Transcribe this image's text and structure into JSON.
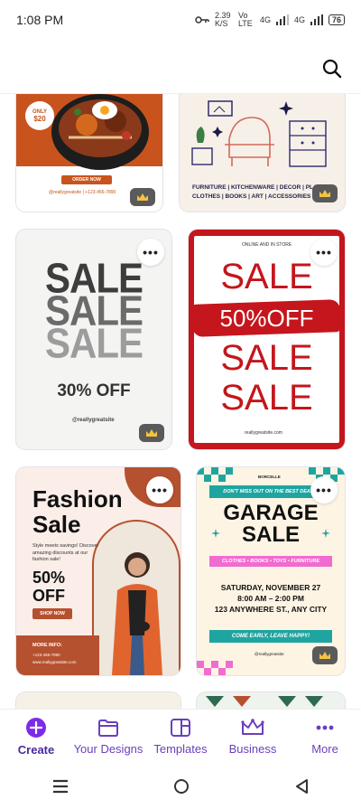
{
  "status": {
    "time": "1:08 PM",
    "net_speed": "2.39 K/S",
    "net1": "Vo LTE",
    "net2": "4G",
    "battery": "76"
  },
  "cards": {
    "food": {
      "badge_top": "ONLY",
      "badge_price": "$20",
      "button": "ORDER NOW",
      "footer": "@reallygreatsite | +123-456-7890"
    },
    "furniture": {
      "line1": "FURNITURE | KITCHENWARE | DECOR | PLANTS",
      "line2": "CLOTHES | BOOKS | ART | ACCESSORIES | SHOE"
    },
    "sale_gray": {
      "word": "SALE",
      "discount": "30% OFF",
      "handle": "@reallygreatsite"
    },
    "sale_red": {
      "top": "ONLINE AND IN STORE",
      "word": "SALE",
      "discount": "50%OFF",
      "site": "reallygreatsite.com"
    },
    "fashion": {
      "title1": "Fashion",
      "title2": "Sale",
      "desc": "Style meets savings! Discover amazing discounts at our fashion sale!",
      "discount1": "50%",
      "discount2": "OFF",
      "button": "SHOP NOW",
      "info_label": "MORE INFO:",
      "phone": "+123-456-7890",
      "site": "www.reallygreatsite.com"
    },
    "garage": {
      "brand": "BORCELLE",
      "tag": "DON'T MISS OUT ON THE BEST DEALS!",
      "title1": "GARAGE",
      "title2": "SALE",
      "items": "CLOTHES • BOOKS • TOYS • FURNITURE",
      "date": "SATURDAY, NOVEMBER 27",
      "time": "8:00 AM – 2:00 PM",
      "address": "123 ANYWHERE ST., ANY CITY",
      "cta": "COME EARLY, LEAVE HAPPY!",
      "site": "@reallygreatsite"
    }
  },
  "nav": [
    {
      "label": "Create"
    },
    {
      "label": "Your Designs"
    },
    {
      "label": "Templates"
    },
    {
      "label": "Business"
    },
    {
      "label": "More"
    }
  ],
  "colors": {
    "accent": "#7d2ae8",
    "nav_text": "#6b3fbd",
    "sale_red": "#c4161c",
    "garage_teal": "#1fa5a0",
    "fashion_brown": "#b5512f"
  }
}
